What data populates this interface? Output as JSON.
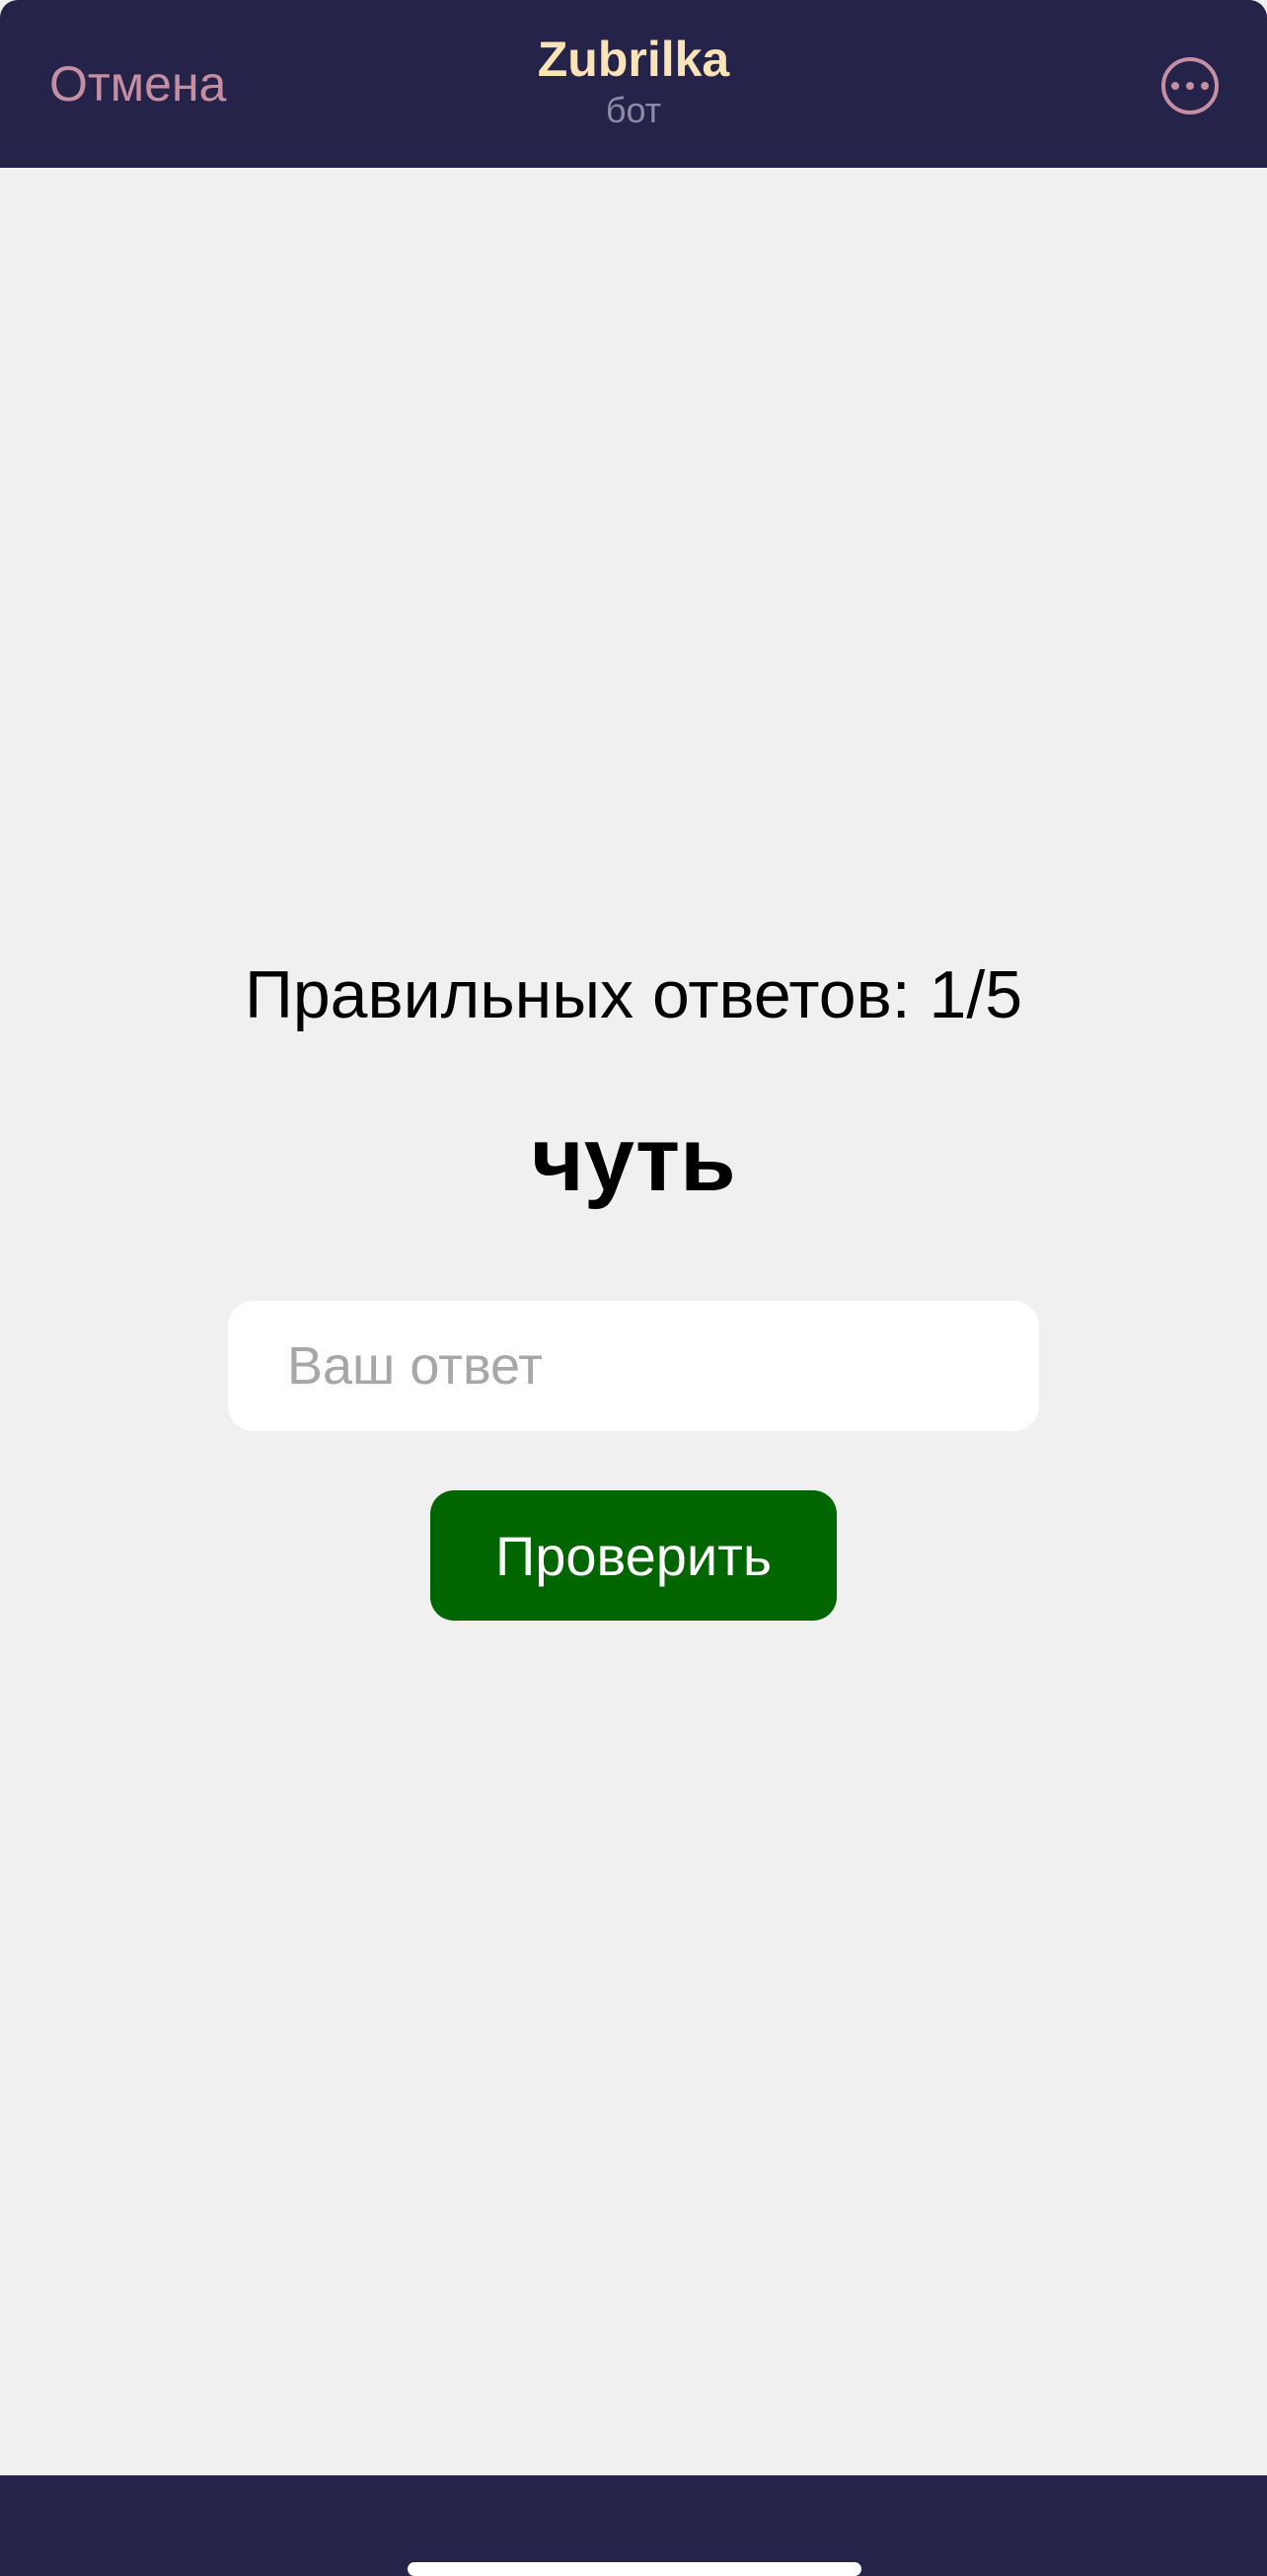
{
  "header": {
    "cancel_label": "Отмена",
    "title": "Zubrilka",
    "subtitle": "бот",
    "more_icon": "more-horizontal-circle-icon"
  },
  "quiz": {
    "score_text": "Правильных ответов: 1/5",
    "word": "чуть",
    "answer": {
      "value": "",
      "placeholder": "Ваш ответ"
    },
    "check_label": "Проверить"
  },
  "colors": {
    "header_bg": "#26234a",
    "accent": "#c48fa2",
    "title": "#fbe3b8",
    "button_bg": "#026600",
    "page_bg": "#f0f0f0"
  }
}
